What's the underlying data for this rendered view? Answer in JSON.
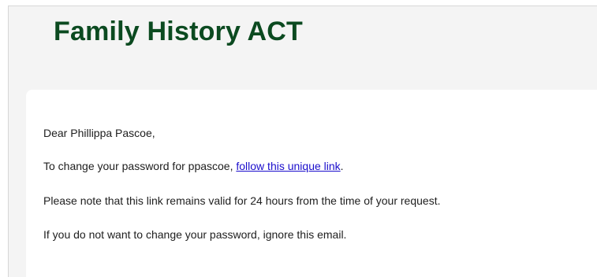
{
  "header": {
    "title": "Family History ACT"
  },
  "email": {
    "greeting": "Dear Phillippa Pascoe,",
    "change_prefix": "To change your password for ppascoe, ",
    "link_text": "follow this unique link",
    "change_suffix": ".",
    "validity_note": "Please note that this link remains valid for 24 hours from the time of your request.",
    "ignore_note": "If you do not want to change your password, ignore this email."
  },
  "colors": {
    "title": "#0b4a20",
    "link": "#1a0dcc",
    "background": "#f4f4f4",
    "card": "#ffffff"
  }
}
